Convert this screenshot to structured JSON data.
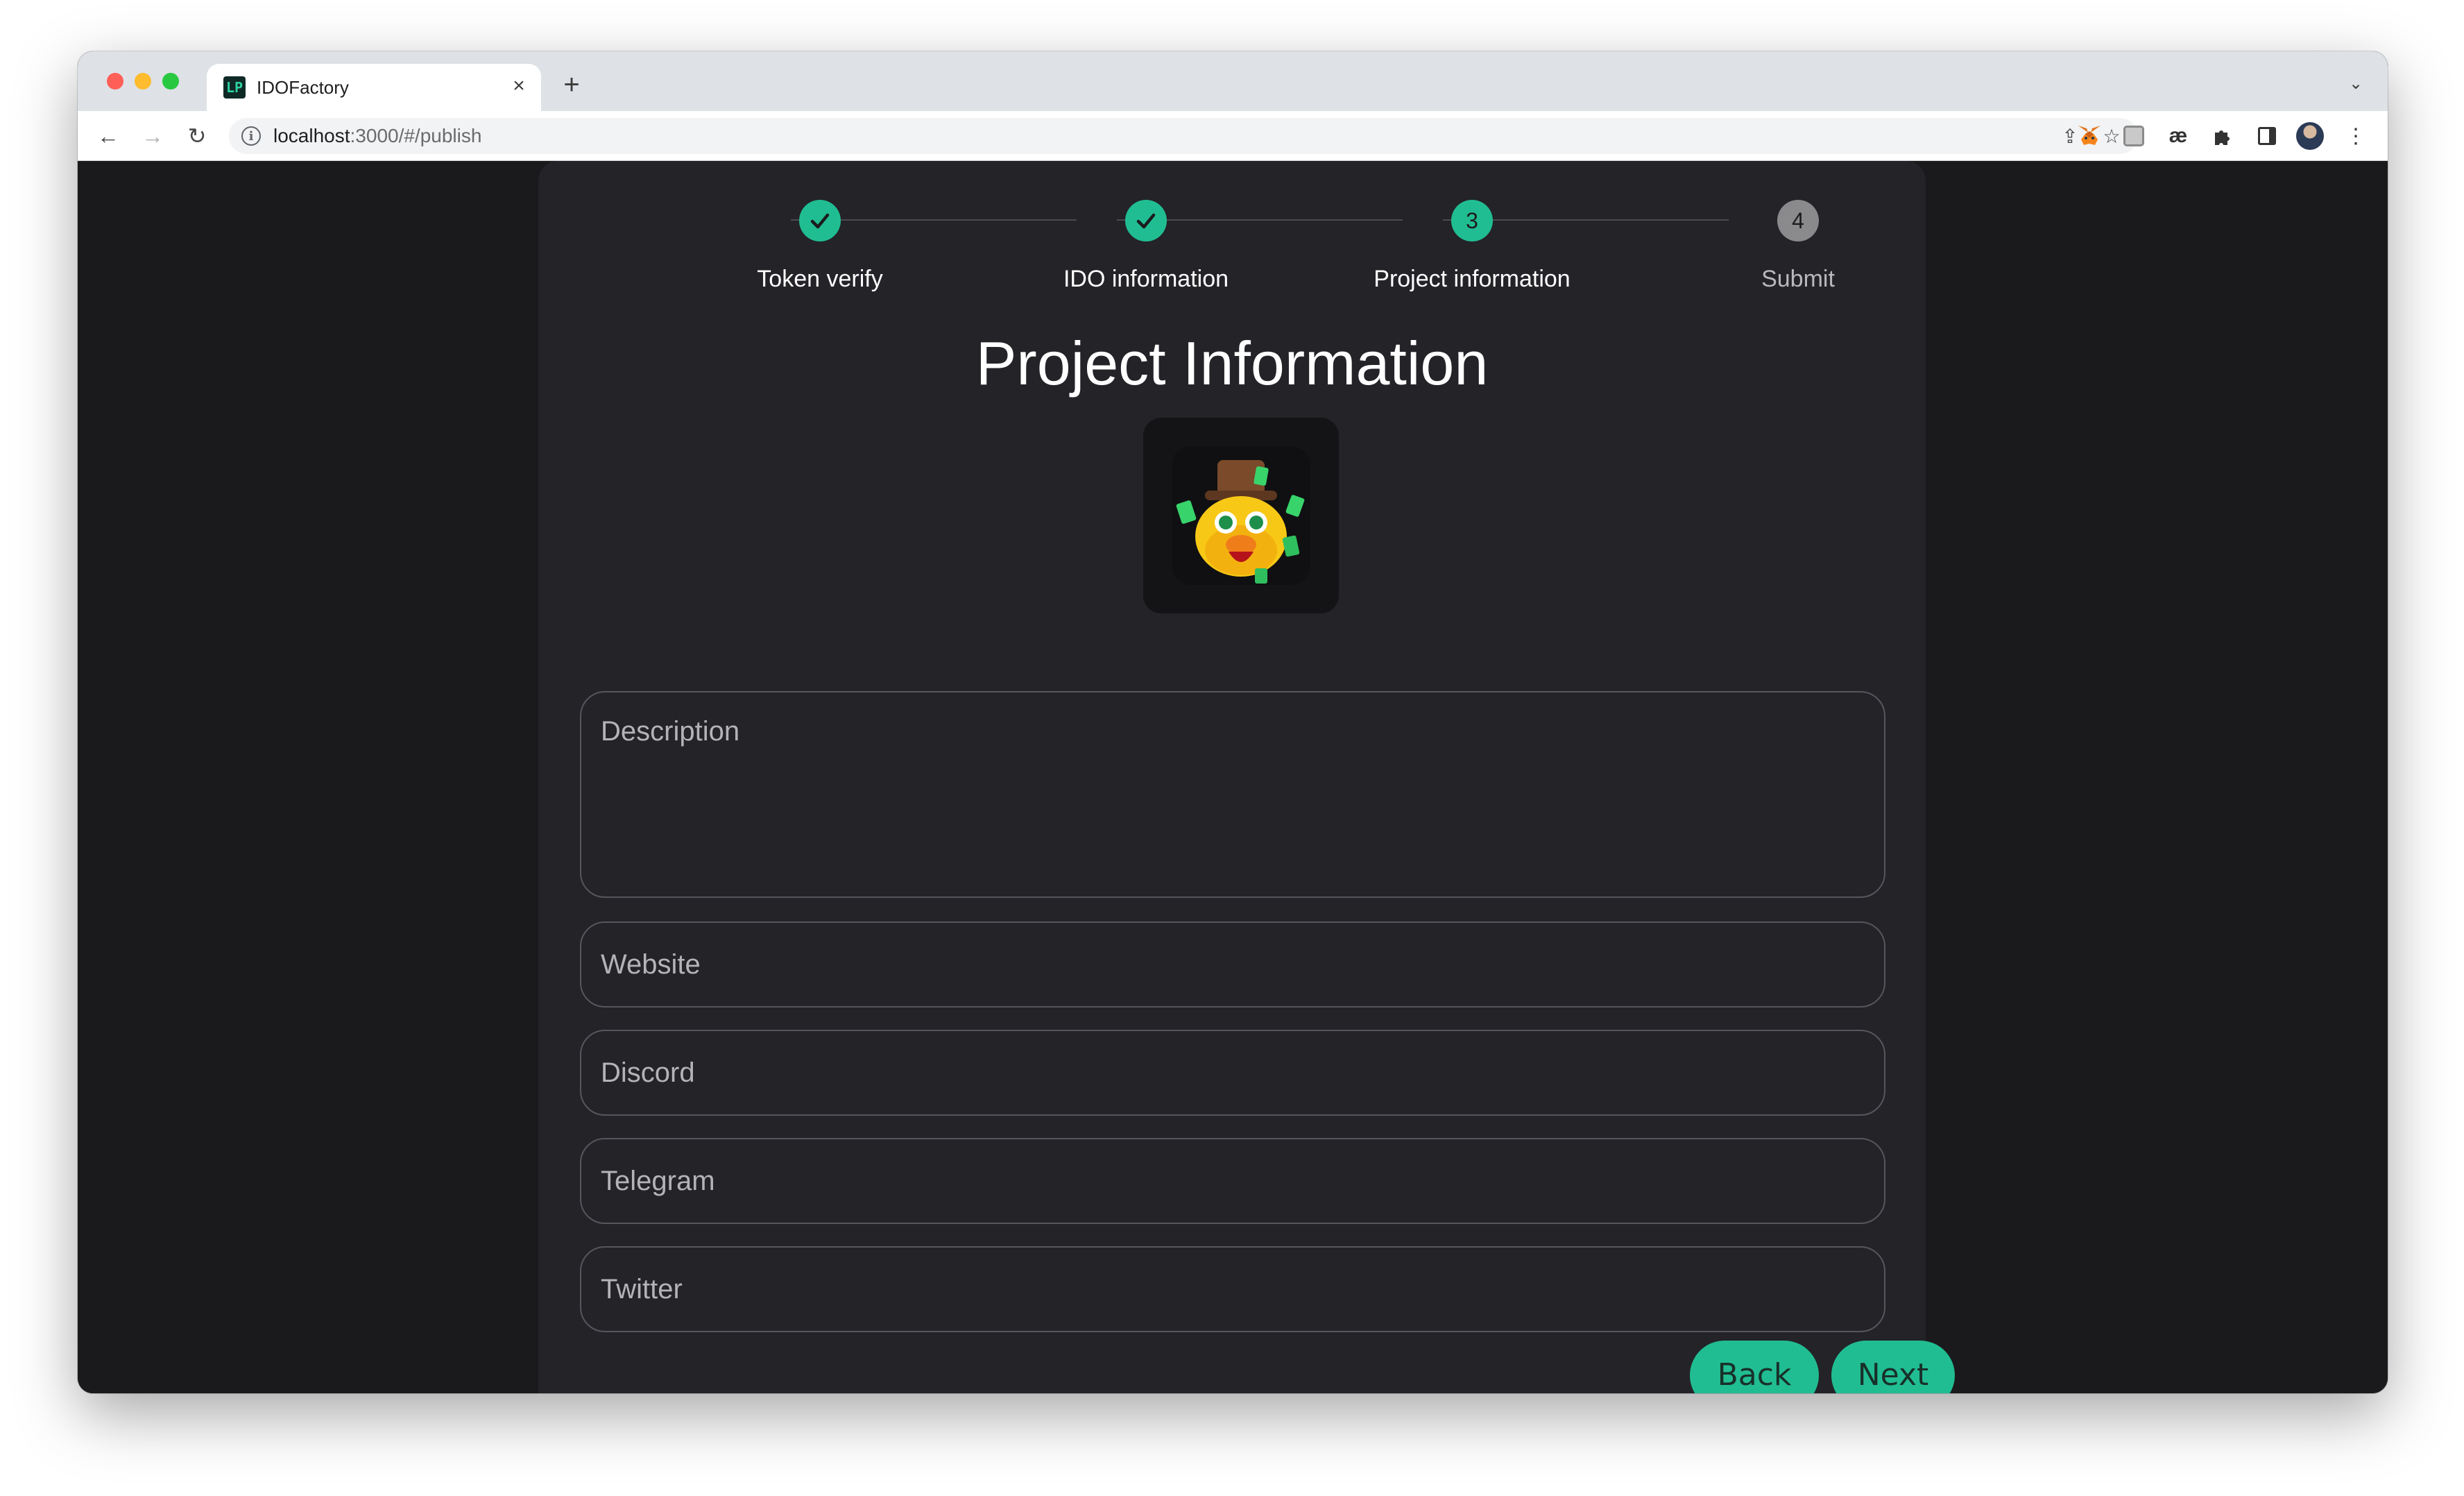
{
  "browser": {
    "tab_title": "IDOFactory",
    "tab_favicon_text": "LP",
    "url_host": "localhost",
    "url_path": ":3000/#/publish",
    "extensions": [
      "metamask-icon",
      "ghost-extension-icon",
      "ae-extension-icon",
      "puzzle-icon",
      "side-panel-icon",
      "profile-avatar",
      "kebab-menu-icon"
    ]
  },
  "stepper": {
    "steps": [
      {
        "label": "Token verify",
        "state": "done",
        "number": ""
      },
      {
        "label": "IDO information",
        "state": "done",
        "number": ""
      },
      {
        "label": "Project information",
        "state": "active",
        "number": "3"
      },
      {
        "label": "Submit",
        "state": "todo",
        "number": "4"
      }
    ]
  },
  "form": {
    "title": "Project Information",
    "description_placeholder": "Description",
    "website_placeholder": "Website",
    "discord_placeholder": "Discord",
    "telegram_placeholder": "Telegram",
    "twitter_placeholder": "Twitter",
    "back_label": "Back",
    "next_label": "Next"
  },
  "colors": {
    "accent": "#21bd92",
    "page_background": "#1a1a1c",
    "card_background": "#232328",
    "step_todo": "#8a8a8c"
  }
}
